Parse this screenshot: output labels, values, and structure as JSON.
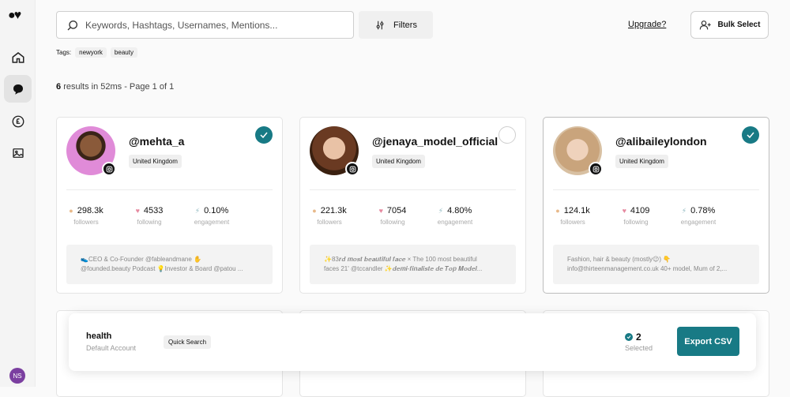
{
  "sidebar": {
    "user_initials": "NS"
  },
  "search": {
    "placeholder": "Keywords, Hashtags, Usernames, Mentions..."
  },
  "toolbar": {
    "filters_label": "Filters",
    "upgrade_label": "Upgrade?",
    "bulk_label": "Bulk Select"
  },
  "tags": {
    "label": "Tags:",
    "items": [
      "newyork",
      "beauty"
    ]
  },
  "results": {
    "count": "6",
    "summary": "results in 52ms - Page 1 of 1"
  },
  "cards": [
    {
      "handle": "@mehta_a",
      "country": "United Kingdom",
      "selected": true,
      "followers": "298.3k",
      "following": "4533",
      "engagement": "0.10%",
      "bio_line1": "👟CEO & Co-Founder @fableandmane ✋",
      "bio_line2": "@founded.beauty Podcast 💡Investor & Board @patou ..."
    },
    {
      "handle": "@jenaya_model_official",
      "country": "United Kingdom",
      "selected": false,
      "followers": "221.3k",
      "following": "7054",
      "engagement": "4.80%",
      "bio_line1": "✨83𝒓𝒅 𝒎𝒐𝒔𝒕 𝒃𝒆𝒂𝒖𝒕𝒊𝒇𝒖𝒍 𝒇𝒂𝒄𝒆 × The 100 most beautiful",
      "bio_line2": "faces 21' @tccandler ✨𝒅𝒆𝒎𝒊-𝒇𝒊𝒏𝒂𝒍𝒊𝒔𝒕𝒆 𝒅𝒆 𝑻𝒐𝒑 𝑴𝒐𝒅𝒆𝒍..."
    },
    {
      "handle": "@alibaileylondon",
      "country": "United Kingdom",
      "selected": true,
      "followers": "124.1k",
      "following": "4109",
      "engagement": "0.78%",
      "bio_line1": "Fashion, hair & beauty (mostly😉) 👇",
      "bio_line2": "info@thirteenmanagement.co.uk 40+ model, Mum of 2,..."
    }
  ],
  "stat_labels": {
    "followers": "followers",
    "following": "following",
    "engagement": "engagement"
  },
  "bottombar": {
    "account_name": "health",
    "account_sub": "Default Account",
    "quick_search": "Quick Search",
    "selected_count": "2",
    "selected_label": "Selected",
    "export_label": "Export CSV"
  },
  "colors": {
    "accent": "#187a85",
    "user_avatar": "#7b3fa0"
  }
}
